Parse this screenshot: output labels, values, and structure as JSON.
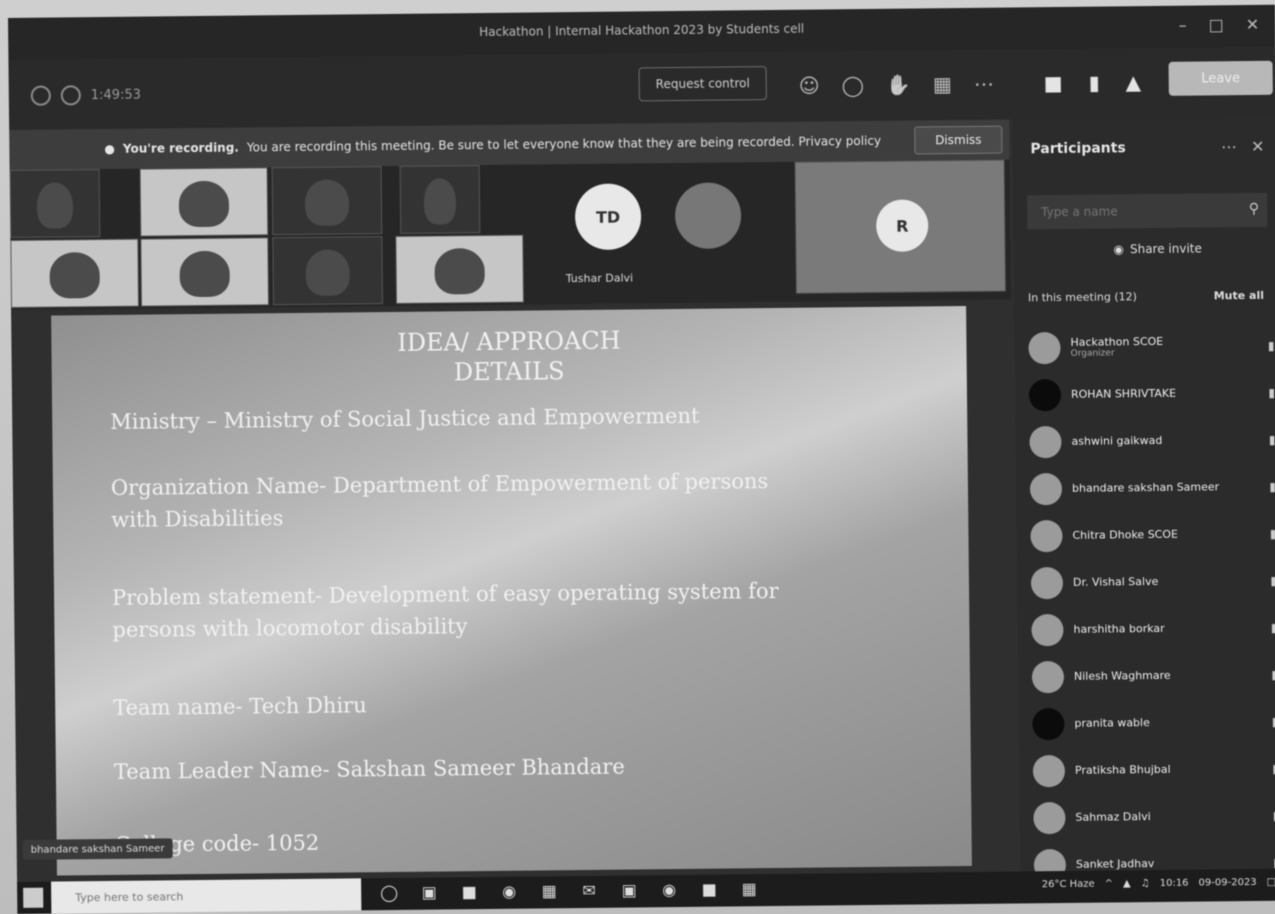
{
  "window": {
    "title": "Hackathon | Internal Hackathon 2023 by Students cell"
  },
  "toolbar": {
    "timer": "1:49:53",
    "request_control_label": "Request control",
    "leave_label": "Leave"
  },
  "banner": {
    "bold": "You're recording.",
    "text": "You are recording this meeting. Be sure to let everyone know that they are being recorded. Privacy policy",
    "dismiss_label": "Dismiss"
  },
  "gallery": {
    "avatar_initials": "TD",
    "avatar_name": "Tushar Dalvi",
    "avatar2_initials": "R"
  },
  "slide": {
    "heading_line1": "IDEA/ APPROACH",
    "heading_line2": "DETAILS",
    "lines": [
      "Ministry – Ministry of Social Justice and Empowerment",
      "Organization Name- Department of Empowerment of  persons",
      "with Disabilities",
      "Problem statement- Development of easy operating system for",
      "persons with locomotor disability",
      "Team name- Tech Dhiru",
      "Team Leader Name- Sakshan Sameer Bhandare",
      "College code- 1052"
    ]
  },
  "participants": {
    "title": "Participants",
    "search_placeholder": "Type a name",
    "share_invite_label": "Share invite",
    "in_meeting_label": "In this meeting (12)",
    "mute_all_label": "Mute all",
    "list": [
      {
        "name": "Hackathon SCOE",
        "sub": "Organizer"
      },
      {
        "name": "ROHAN SHRIVTAKE",
        "sub": ""
      },
      {
        "name": "ashwini gaikwad",
        "sub": ""
      },
      {
        "name": "bhandare sakshan Sameer",
        "sub": ""
      },
      {
        "name": "Chitra Dhoke SCOE",
        "sub": ""
      },
      {
        "name": "Dr. Vishal Salve",
        "sub": ""
      },
      {
        "name": "harshitha borkar",
        "sub": ""
      },
      {
        "name": "Nilesh Waghmare",
        "sub": ""
      },
      {
        "name": "pranita wable",
        "sub": ""
      },
      {
        "name": "Pratiksha Bhujbal",
        "sub": ""
      },
      {
        "name": "Sahmaz Dalvi",
        "sub": ""
      },
      {
        "name": "Sanket Jadhav",
        "sub": ""
      }
    ]
  },
  "presenter_chip": "bhandare sakshan Sameer",
  "taskbar": {
    "search_placeholder": "Type here to search",
    "weather": "26°C Haze",
    "time": "10:16",
    "date": "09-09-2023"
  }
}
